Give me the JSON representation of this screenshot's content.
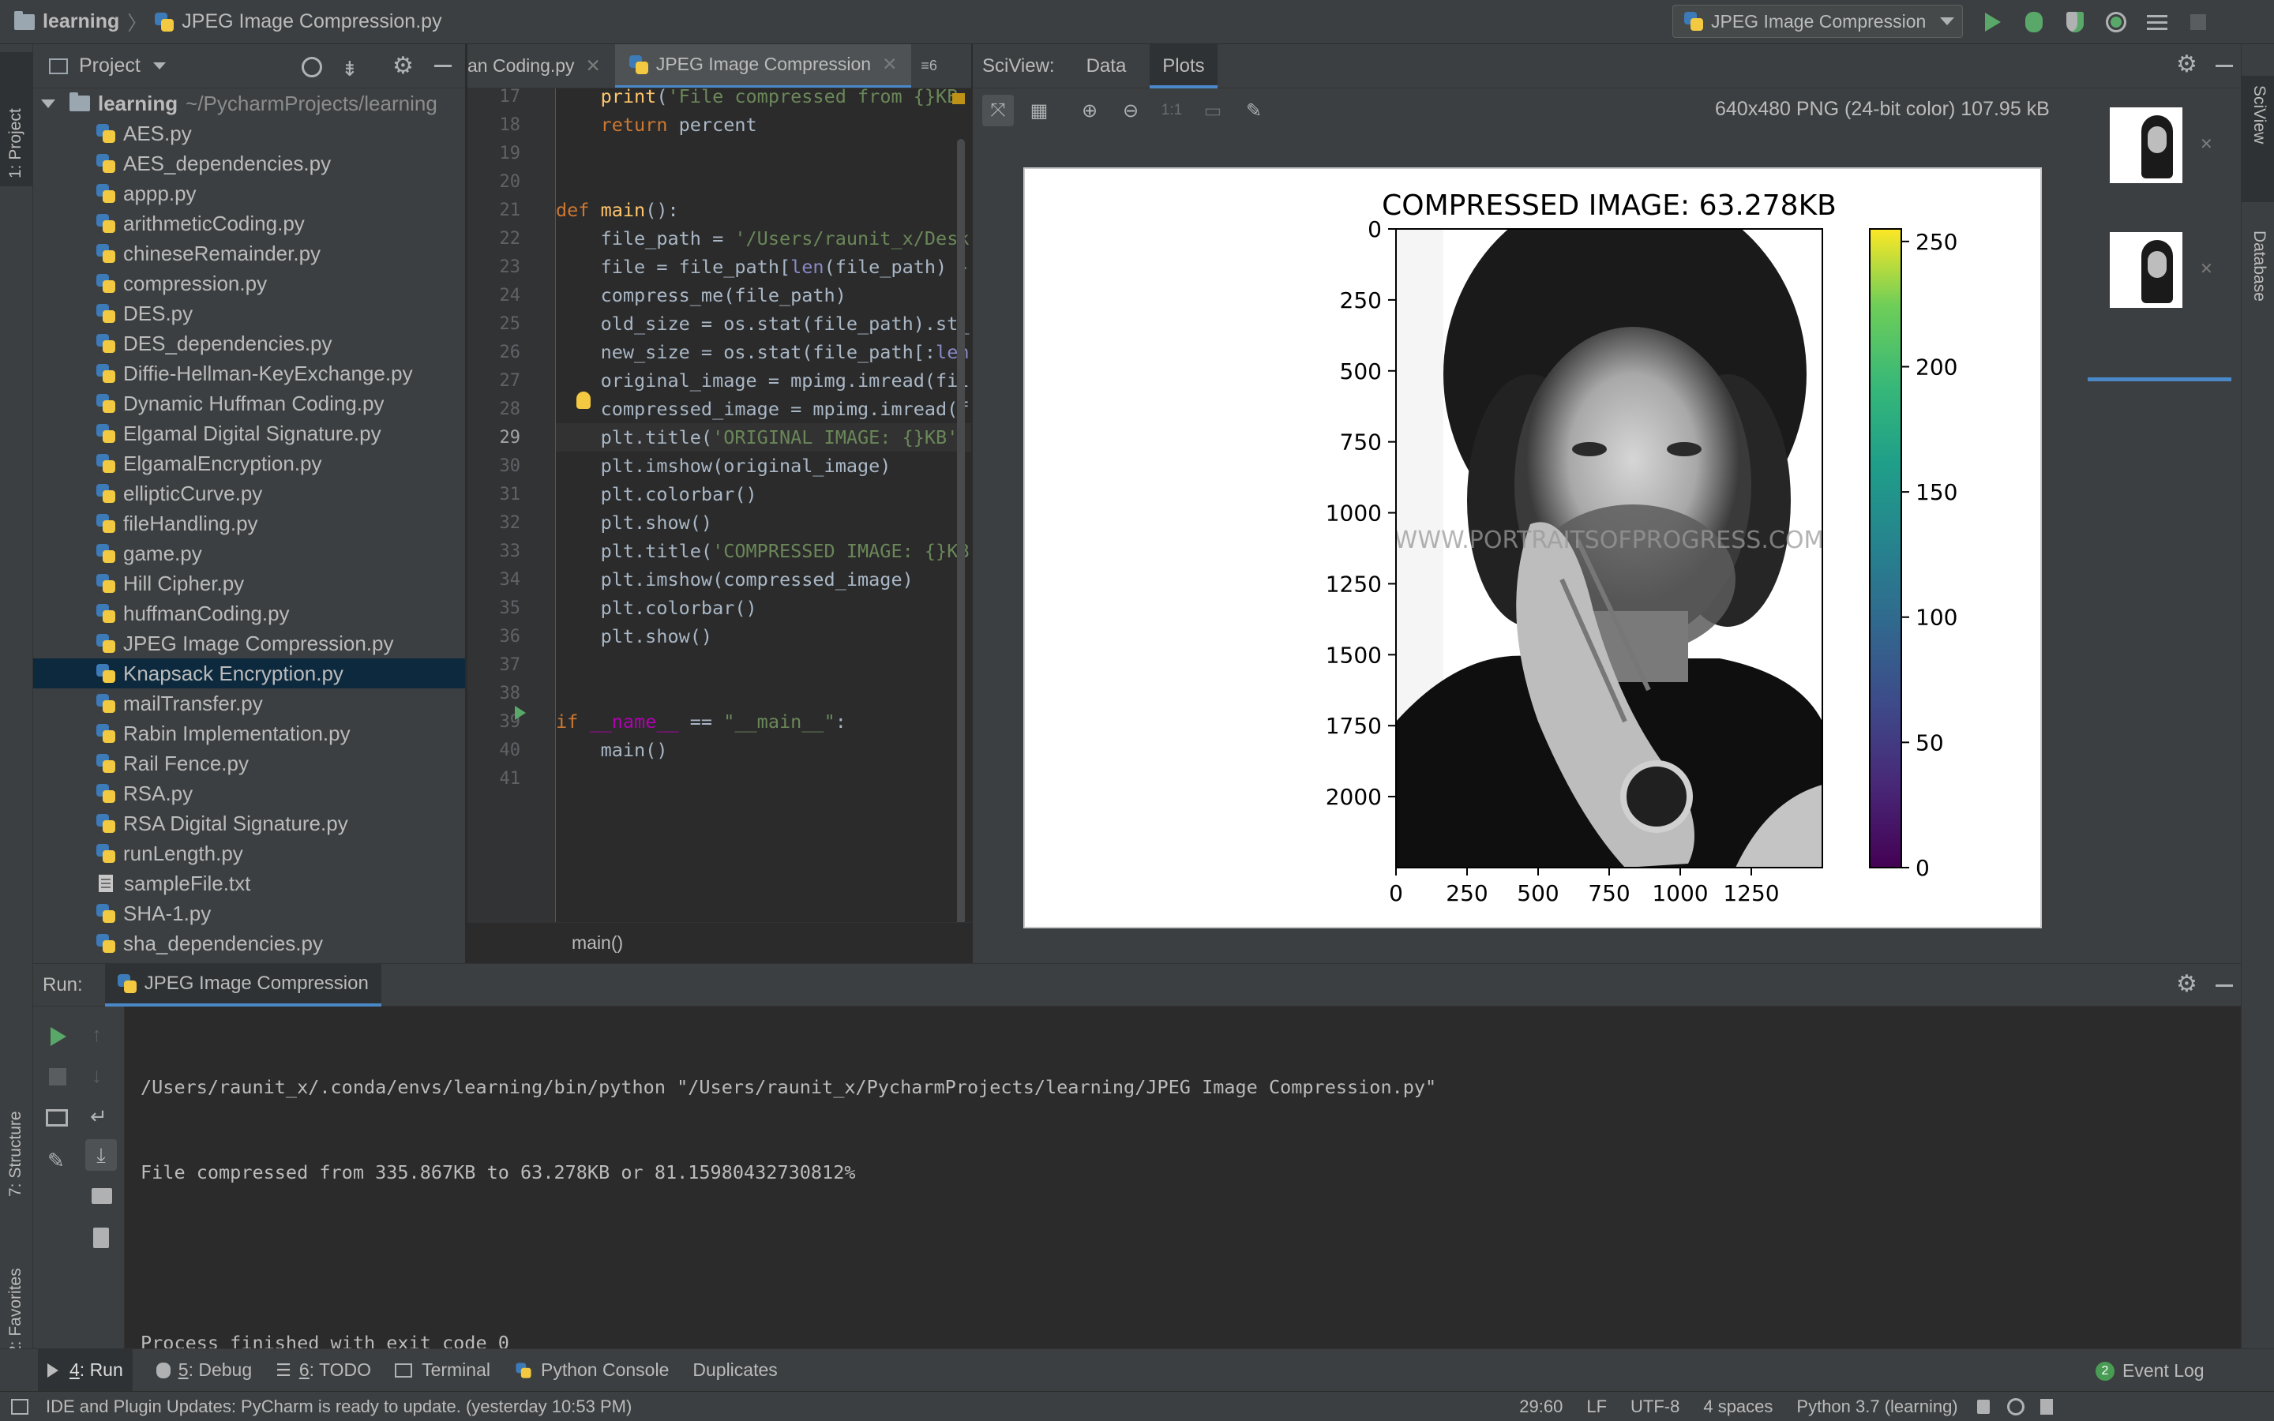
{
  "navbar": {
    "project": "learning",
    "file": "JPEG Image Compression.py",
    "run_config": "JPEG Image Compression"
  },
  "left_strip": {
    "project_tab": "1: Project",
    "structure_tab": "7: Structure",
    "favorites_tab": "2: Favorites"
  },
  "right_strip": {
    "sciview_tab": "SciView",
    "database_tab": "Database"
  },
  "project_panel": {
    "title": "Project",
    "root": {
      "name": "learning",
      "path": "~/PycharmProjects/learning"
    },
    "files": [
      {
        "name": "AES.py",
        "type": "py"
      },
      {
        "name": "AES_dependencies.py",
        "type": "py"
      },
      {
        "name": "appp.py",
        "type": "py"
      },
      {
        "name": "arithmeticCoding.py",
        "type": "py"
      },
      {
        "name": "chineseRemainder.py",
        "type": "py"
      },
      {
        "name": "compression.py",
        "type": "py"
      },
      {
        "name": "DES.py",
        "type": "py"
      },
      {
        "name": "DES_dependencies.py",
        "type": "py"
      },
      {
        "name": "Diffie-Hellman-KeyExchange.py",
        "type": "py"
      },
      {
        "name": "Dynamic Huffman Coding.py",
        "type": "py"
      },
      {
        "name": "Elgamal Digital Signature.py",
        "type": "py"
      },
      {
        "name": "ElgamalEncryption.py",
        "type": "py"
      },
      {
        "name": "ellipticCurve.py",
        "type": "py"
      },
      {
        "name": "fileHandling.py",
        "type": "py"
      },
      {
        "name": "game.py",
        "type": "py"
      },
      {
        "name": "Hill Cipher.py",
        "type": "py"
      },
      {
        "name": "huffmanCoding.py",
        "type": "py"
      },
      {
        "name": "JPEG Image Compression.py",
        "type": "py"
      },
      {
        "name": "Knapsack Encryption.py",
        "type": "py",
        "selected": true
      },
      {
        "name": "mailTransfer.py",
        "type": "py"
      },
      {
        "name": "Rabin Implementation.py",
        "type": "py"
      },
      {
        "name": "Rail Fence.py",
        "type": "py"
      },
      {
        "name": "RSA.py",
        "type": "py"
      },
      {
        "name": "RSA Digital Signature.py",
        "type": "py"
      },
      {
        "name": "runLength.py",
        "type": "py"
      },
      {
        "name": "sampleFile.txt",
        "type": "txt"
      },
      {
        "name": "SHA-1.py",
        "type": "py"
      },
      {
        "name": "sha_dependencies.py",
        "type": "py"
      }
    ]
  },
  "editor": {
    "tabs": [
      {
        "label": "an Coding.py",
        "active": false
      },
      {
        "label": "JPEG Image Compression",
        "active": true
      }
    ],
    "tab_overflow": "6",
    "line_numbers": [
      "17",
      "18",
      "19",
      "20",
      "21",
      "22",
      "23",
      "24",
      "25",
      "26",
      "27",
      "28",
      "29",
      "30",
      "31",
      "32",
      "33",
      "34",
      "35",
      "36",
      "37",
      "38",
      "39",
      "40",
      "41"
    ],
    "breadcrumb": "main()"
  },
  "sciview": {
    "label": "SciView:",
    "tab_data": "Data",
    "tab_plots": "Plots",
    "image_info": "640x480 PNG (24-bit color) 107.95 kB",
    "zoom_label": "1:1"
  },
  "chart_data": {
    "type": "heatmap",
    "title": "COMPRESSED IMAGE: 63.278KB",
    "xlabel": "",
    "ylabel": "",
    "x_ticks": [
      0,
      250,
      500,
      750,
      1000,
      1250
    ],
    "y_ticks": [
      0,
      250,
      500,
      750,
      1000,
      1250,
      1500,
      1750,
      2000
    ],
    "xlim": [
      0,
      1500
    ],
    "ylim": [
      2250,
      0
    ],
    "colorbar": {
      "colormap": "viridis",
      "ticks": [
        0,
        50,
        100,
        150,
        200,
        250
      ],
      "range": [
        0,
        255
      ]
    },
    "image_watermark": "WWW.PORTRAITSOFPROGRESS.COM"
  },
  "run_panel": {
    "label": "Run:",
    "tab": "JPEG Image Compression",
    "console": [
      "/Users/raunit_x/.conda/envs/learning/bin/python \"/Users/raunit_x/PycharmProjects/learning/JPEG Image Compression.py\"",
      "File compressed from 335.867KB to 63.278KB or 81.15980432730812%",
      "",
      "Process finished with exit code 0"
    ]
  },
  "bottom_tabs": {
    "run": {
      "num": "4",
      "label": ": Run"
    },
    "debug": {
      "num": "5",
      "label": ": Debug"
    },
    "todo": {
      "num": "6",
      "label": ": TODO"
    },
    "terminal": "Terminal",
    "python_console": "Python Console",
    "duplicates": "Duplicates",
    "event_log": "Event Log",
    "event_count": "2"
  },
  "status_bar": {
    "message": "IDE and Plugin Updates: PyCharm is ready to update. (yesterday 10:53 PM)",
    "position": "29:60",
    "line_sep": "LF",
    "encoding": "UTF-8",
    "indent": "4 spaces",
    "interpreter": "Python 3.7 (learning)"
  },
  "colors": {
    "accent": "#4a88c7",
    "run_green": "#59a869",
    "selection": "#0d293e"
  }
}
